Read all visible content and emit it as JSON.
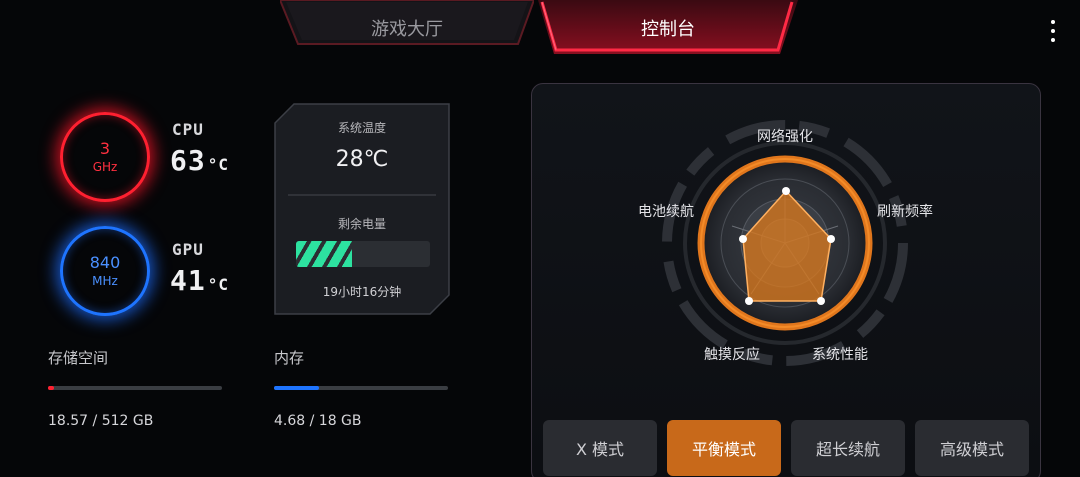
{
  "tabs": {
    "game_lobby": "游戏大厅",
    "control_panel": "控制台"
  },
  "cpu": {
    "freq_value": "3",
    "freq_unit": "GHz",
    "label": "CPU",
    "temp": "63",
    "temp_unit": "°C"
  },
  "gpu": {
    "freq_value": "840",
    "freq_unit": "MHz",
    "label": "GPU",
    "temp": "41",
    "temp_unit": "°C"
  },
  "system": {
    "temp_label": "系统温度",
    "temp_value": "28℃",
    "battery_label": "剩余电量",
    "battery_time": "19小时16分钟",
    "battery_level": 0.42
  },
  "storage": {
    "label": "存储空间",
    "value": "18.57 / 512 GB",
    "fraction": 0.036
  },
  "memory": {
    "label": "内存",
    "value": "4.68 / 18 GB",
    "fraction": 0.26
  },
  "radar": {
    "axes": [
      "网络强化",
      "刷新频率",
      "系统性能",
      "触摸反应",
      "电池续航"
    ]
  },
  "modes": {
    "items": [
      "X 模式",
      "平衡模式",
      "超长续航",
      "高级模式"
    ],
    "active": "平衡模式"
  },
  "colors": {
    "accent_red": "#ff2030",
    "accent_blue": "#1e74ff",
    "accent_orange": "#c8691a",
    "battery_green": "#2de2a0"
  }
}
